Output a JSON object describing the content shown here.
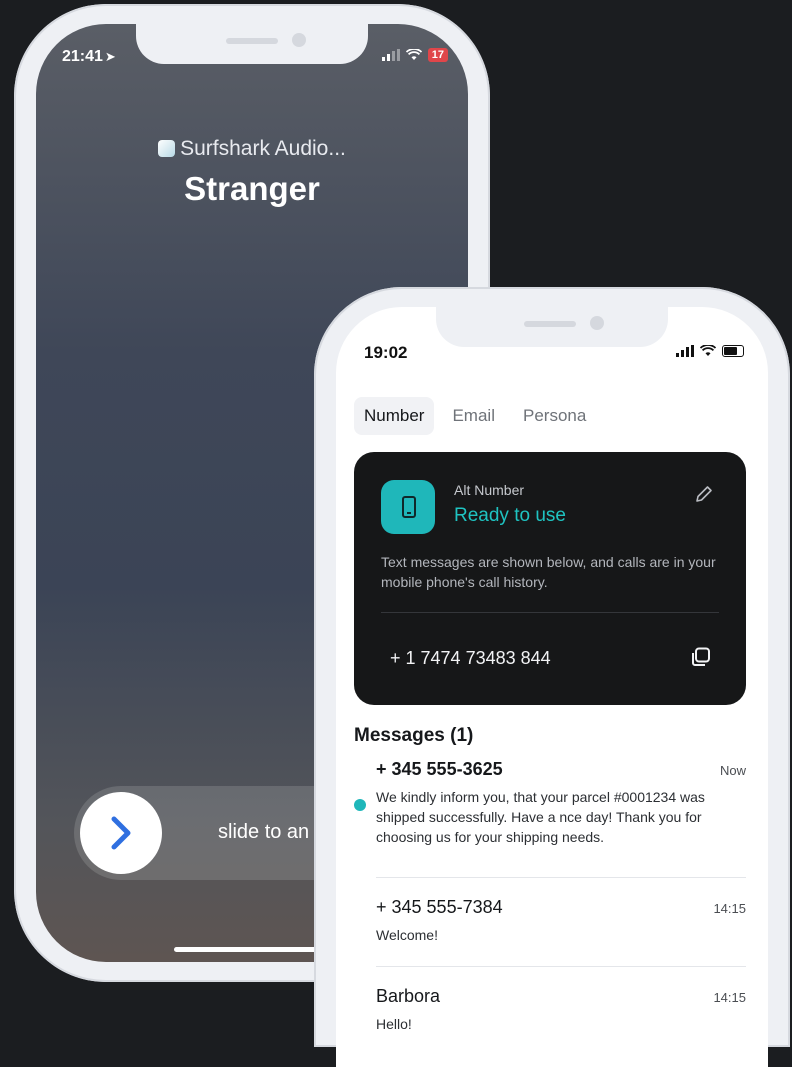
{
  "colors": {
    "page_background": "#1b1d20",
    "accent_teal": "#1fb7ba",
    "card_background": "#161718",
    "battery_low": "#e0464a"
  },
  "call_phone": {
    "status_bar": {
      "time": "21:41",
      "battery": "17"
    },
    "caller_app": "Surfshark Audio...",
    "caller_name": "Stranger",
    "slider": {
      "text_dim": "slid",
      "text_bright": "e to an",
      "icon": "chevron-right-icon"
    }
  },
  "app_phone": {
    "status_bar": {
      "time": "19:02"
    },
    "tabs": [
      {
        "label": "Number",
        "active": true
      },
      {
        "label": "Email",
        "active": false
      },
      {
        "label": "Persona",
        "active": false
      }
    ],
    "number_card": {
      "label": "Alt Number",
      "status": "Ready to use",
      "description": "Text messages are shown below, and calls are in your mobile phone's call history.",
      "phone_number": "+ 1 7474 73483 844",
      "icons": [
        "phone-icon",
        "pencil-icon",
        "copy-icon"
      ]
    },
    "messages_title": "Messages (1)",
    "messages": [
      {
        "from": "+ 345 555-3625",
        "time": "Now",
        "body": "We kindly inform you, that your parcel #0001234 was shipped successfully. Have a nce day! Thank you for choosing us for your shipping needs.",
        "unread": true
      },
      {
        "from": "+ 345 555-7384",
        "time": "14:15",
        "body": "Welcome!",
        "unread": false
      },
      {
        "from": "Barbora",
        "time": "14:15",
        "body": "Hello!",
        "unread": false
      }
    ]
  }
}
